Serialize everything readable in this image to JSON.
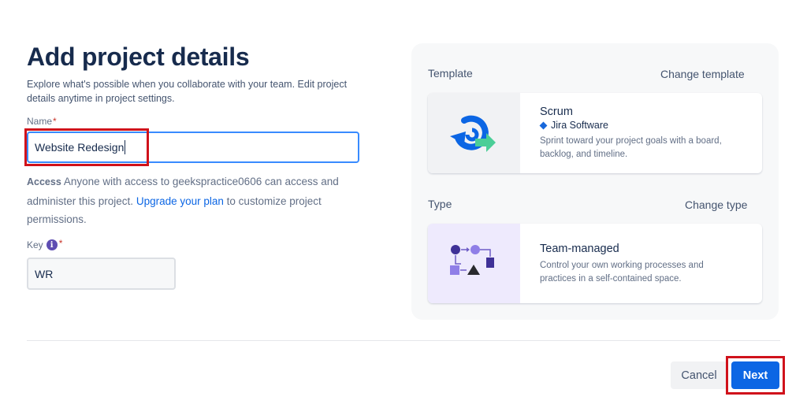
{
  "header": {
    "title": "Add project details",
    "subtitle": "Explore what's possible when you collaborate with your team. Edit project details anytime in project settings."
  },
  "form": {
    "name_label": "Name",
    "required_mark": "*",
    "name_value": "Website Redesign",
    "access_label": "Access",
    "access_text": "Anyone with access to geekspractice0606 can access and administer this project.",
    "upgrade_link": "Upgrade your plan",
    "access_suffix": "to customize project permissions.",
    "key_label": "Key",
    "key_value": "WR",
    "info_glyph": "i"
  },
  "template": {
    "section_label": "Template",
    "change_link": "Change template",
    "name": "Scrum",
    "product": "Jira Software",
    "description": "Sprint toward your project goals with a board, backlog, and timeline."
  },
  "type": {
    "section_label": "Type",
    "change_link": "Change type",
    "name": "Team-managed",
    "description": "Control your own working processes and practices in a self-contained space."
  },
  "footer": {
    "cancel_label": "Cancel",
    "next_label": "Next"
  },
  "colors": {
    "primary": "#0c66e4",
    "highlight": "#d0121b",
    "focus": "#388bff"
  }
}
